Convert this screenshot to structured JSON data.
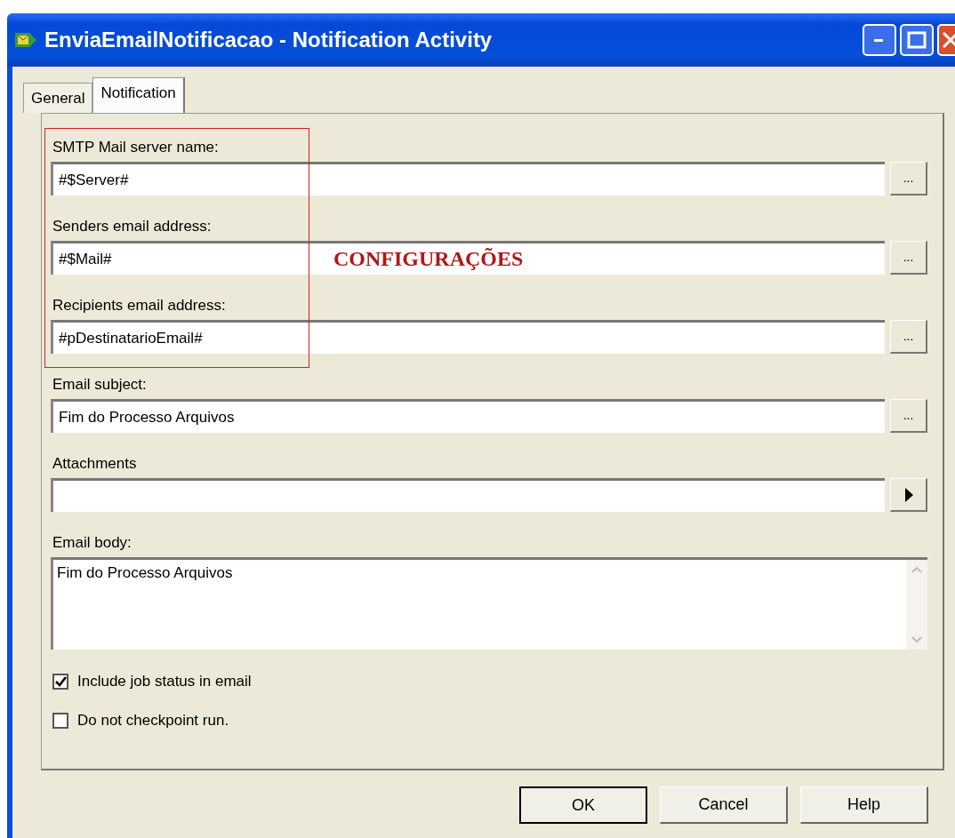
{
  "window": {
    "title": "EnviaEmailNotificacao - Notification Activity"
  },
  "tabs": [
    {
      "label": "General",
      "selected": false
    },
    {
      "label": "Notification",
      "selected": true
    }
  ],
  "fields": [
    {
      "label": "SMTP Mail server name:",
      "value": "#$Server#",
      "kind": "browse",
      "button_label": "..."
    },
    {
      "label": "Senders email address:",
      "value": "#$Mail#",
      "kind": "browse",
      "button_label": "..."
    },
    {
      "label": "Recipients email address:",
      "value": "#pDestinatarioEmail#",
      "kind": "browse",
      "button_label": "..."
    },
    {
      "label": "Email subject:",
      "value": "Fim do Processo Arquivos",
      "kind": "browse",
      "button_label": "..."
    },
    {
      "label": "Attachments",
      "kind": "arrow"
    }
  ],
  "body": {
    "label": "Email body:",
    "value": "Fim do Processo Arquivos"
  },
  "checkboxes": [
    {
      "label": "Include job status in email",
      "checked": true
    },
    {
      "label": "Do not checkpoint run.",
      "checked": false
    }
  ],
  "annotation": {
    "text": "CONFIGURAÇÕES"
  },
  "buttons": [
    {
      "label": "OK",
      "default": true
    },
    {
      "label": "Cancel",
      "default": false
    },
    {
      "label": "Help",
      "default": false
    }
  ]
}
